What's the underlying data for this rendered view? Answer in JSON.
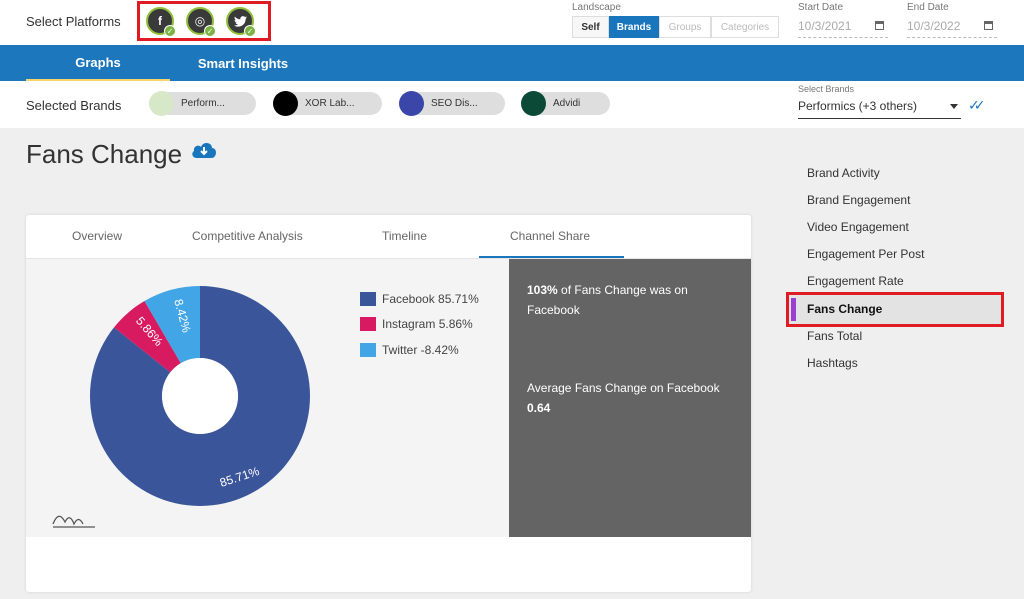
{
  "platforms": {
    "label": "Select Platforms",
    "items": [
      {
        "name": "facebook",
        "glyph": "f"
      },
      {
        "name": "instagram",
        "glyph": "◎"
      },
      {
        "name": "twitter",
        "glyph": "🐦"
      }
    ]
  },
  "landscape": {
    "label": "Landscape",
    "options": [
      "Self",
      "Brands",
      "Groups",
      "Categories"
    ],
    "selected": "Brands"
  },
  "dates": {
    "start_label": "Start Date",
    "start_value": "10/3/2021",
    "end_label": "End Date",
    "end_value": "10/3/2022"
  },
  "nav": {
    "tabs": [
      "Graphs",
      "Smart Insights"
    ],
    "active": "Graphs"
  },
  "selected_brands": {
    "label": "Selected Brands",
    "brands": [
      {
        "name": "Perform...",
        "color": "#d7e8c8"
      },
      {
        "name": "XOR Lab...",
        "color": "#000000"
      },
      {
        "name": "SEO Dis...",
        "color": "#3a47a8"
      },
      {
        "name": "Advidi",
        "color": "#0b4a36"
      }
    ],
    "select_label": "Select Brands",
    "select_value": "Performics (+3 others)"
  },
  "page": {
    "title": "Fans Change"
  },
  "card": {
    "tabs": [
      "Overview",
      "Competitive Analysis",
      "Timeline",
      "Channel Share"
    ],
    "active_tab": "Channel Share"
  },
  "chart_data": {
    "type": "pie",
    "donut": true,
    "title": "",
    "categories": [
      "Facebook",
      "Instagram",
      "Twitter"
    ],
    "values": [
      85.71,
      5.86,
      -8.42
    ],
    "slice_labels": [
      "85.71%",
      "5.86%",
      "8.42%"
    ],
    "legend": [
      "Facebook 85.71%",
      "Instagram 5.86%",
      "Twitter -8.42%"
    ],
    "colors": [
      "#3a559a",
      "#d81b60",
      "#42a5e5"
    ],
    "legend_position": "right"
  },
  "insights": {
    "line1_bold": "103%",
    "line1_rest": " of Fans Change was on Facebook",
    "line2_label": "Average Fans Change on Facebook",
    "line2_value": "0.64"
  },
  "right_nav": {
    "items": [
      "Brand Activity",
      "Brand Engagement",
      "Video Engagement",
      "Engagement Per Post",
      "Engagement Rate",
      "Fans Change",
      "Fans Total",
      "Hashtags"
    ],
    "active": "Fans Change"
  },
  "colors": {
    "primary": "#1d77bd",
    "accent_underline": "#f6d36b",
    "highlight_red": "#e01b24",
    "active_marker": "#9b3fd3"
  }
}
